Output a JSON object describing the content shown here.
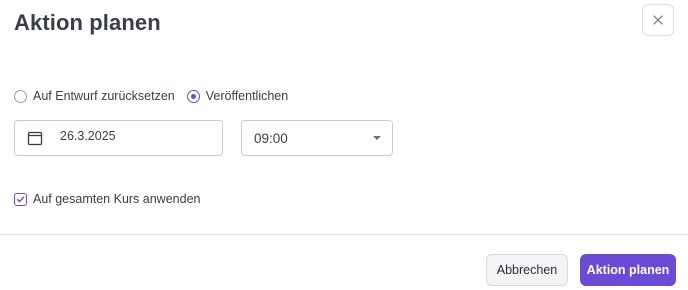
{
  "dialog": {
    "title": "Aktion planen",
    "close_icon": "close-icon"
  },
  "action": {
    "options": [
      {
        "label": "Auf Entwurf zurücksetzen",
        "selected": false
      },
      {
        "label": "Veröffentlichen",
        "selected": true
      }
    ]
  },
  "schedule": {
    "date": "26.3.2025",
    "date_icon": "calendar-icon",
    "time": "09:00",
    "time_icon": "chevron-down-icon"
  },
  "apply_course": {
    "label": "Auf gesamten Kurs anwenden",
    "checked": true
  },
  "footer": {
    "cancel_label": "Abbrechen",
    "submit_label": "Aktion planen"
  },
  "colors": {
    "accent": "#6a4bd6",
    "border": "#c9cdd2",
    "text": "#3a3f47"
  }
}
